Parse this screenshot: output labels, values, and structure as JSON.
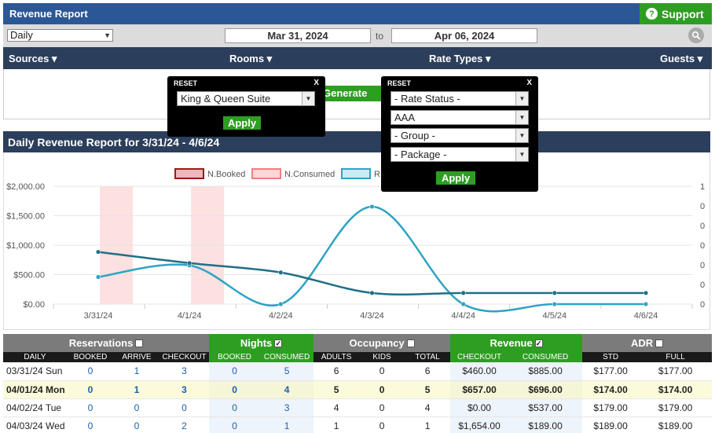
{
  "header": {
    "title": "Revenue Report",
    "support_label": "Support"
  },
  "datebar": {
    "period": "Daily",
    "start_date": "Mar 31, 2024",
    "to_label": "to",
    "end_date": "Apr 06, 2024"
  },
  "filters": {
    "sources": "Sources ▾",
    "rooms": "Rooms ▾",
    "rate_types": "Rate Types ▾",
    "guests": "Guests ▾"
  },
  "generate_label": "Generate Report",
  "rooms_popup": {
    "reset": "RESET",
    "close": "X",
    "room_select": "King & Queen Suite",
    "apply": "Apply"
  },
  "rate_popup": {
    "reset": "RESET",
    "close": "X",
    "rate_status": "- Rate Status -",
    "rate": "AAA",
    "group": "- Group -",
    "package": "- Package -",
    "apply": "Apply"
  },
  "report_title": "Daily Revenue Report for 3/31/24 - 4/6/24",
  "chart_data": {
    "type": "line",
    "legend": [
      "N.Booked",
      "N.Consumed",
      "R"
    ],
    "x": [
      "3/31/24",
      "4/1/24",
      "4/2/24",
      "4/3/24",
      "4/4/24",
      "4/5/24",
      "4/6/24"
    ],
    "y_ticks": [
      "$2,000.00",
      "$1,500.00",
      "$1,000.00",
      "$500.00",
      "$0.00"
    ],
    "y2_ticks": [
      "1",
      "0",
      "0",
      "0",
      "0",
      "0",
      "0"
    ],
    "ylim": [
      0,
      2000
    ],
    "series": [
      {
        "name": "Revenue Booked",
        "values": [
          460,
          657,
          0,
          1654,
          0,
          0,
          0
        ]
      },
      {
        "name": "Revenue Consumed",
        "values": [
          885,
          696,
          537,
          189,
          189,
          189,
          189
        ]
      }
    ],
    "highlight_bands": [
      "3/31/24",
      "4/1/24"
    ],
    "colors": {
      "booked": "#2ea3c4",
      "consumed": "#1f6f86",
      "band": "#fde0e0"
    }
  },
  "table": {
    "groups": [
      {
        "label": "Reservations",
        "checked": false
      },
      {
        "label": "Nights",
        "checked": true
      },
      {
        "label": "Occupancy",
        "checked": false
      },
      {
        "label": "Revenue",
        "checked": true
      },
      {
        "label": "ADR",
        "checked": false
      }
    ],
    "columns": [
      "DAILY",
      "BOOKED",
      "ARRIVE",
      "CHECKOUT",
      "BOOKED",
      "CONSUMED",
      "ADULTS",
      "KIDS",
      "TOTAL",
      "CHECKOUT",
      "CONSUMED",
      "STD",
      "FULL"
    ],
    "rows": [
      [
        "03/31/24 Sun",
        "0",
        "1",
        "3",
        "0",
        "5",
        "6",
        "0",
        "6",
        "$460.00",
        "$885.00",
        "$177.00",
        "$177.00"
      ],
      [
        "04/01/24 Mon",
        "0",
        "1",
        "3",
        "0",
        "4",
        "5",
        "0",
        "5",
        "$657.00",
        "$696.00",
        "$174.00",
        "$174.00"
      ],
      [
        "04/02/24 Tue",
        "0",
        "0",
        "0",
        "0",
        "3",
        "4",
        "0",
        "4",
        "$0.00",
        "$537.00",
        "$179.00",
        "$179.00"
      ],
      [
        "04/03/24 Wed",
        "0",
        "0",
        "2",
        "0",
        "1",
        "1",
        "0",
        "1",
        "$1,654.00",
        "$189.00",
        "$189.00",
        "$189.00"
      ]
    ]
  }
}
